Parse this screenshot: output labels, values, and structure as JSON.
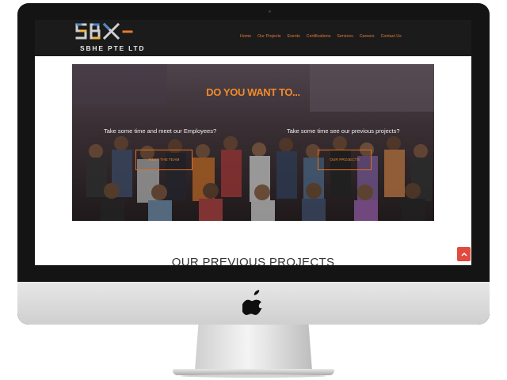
{
  "brand": {
    "logo_text": "SBHE PTE LTD",
    "logo_letters": "SBX"
  },
  "nav": {
    "items": [
      "Home",
      "Our Projects",
      "Events",
      "Certifications",
      "Services",
      "Careers",
      "Contact Us"
    ]
  },
  "hero": {
    "title": "DO YOU WANT TO...",
    "left_text": "Take some time and meet our Employees?",
    "right_text": "Take some time see our previous projects?",
    "left_button": "MEET THE TEAM",
    "right_button": "OUR PROJECTS"
  },
  "section": {
    "title": "OUR PREVIOUS PROJECTS"
  },
  "colors": {
    "accent": "#f08a2b",
    "navbar": "#1b1b1b",
    "scroll_top": "#e04a3f"
  },
  "icons": {
    "apple": "apple-logo-icon",
    "scroll_top": "chevron-up-icon"
  }
}
